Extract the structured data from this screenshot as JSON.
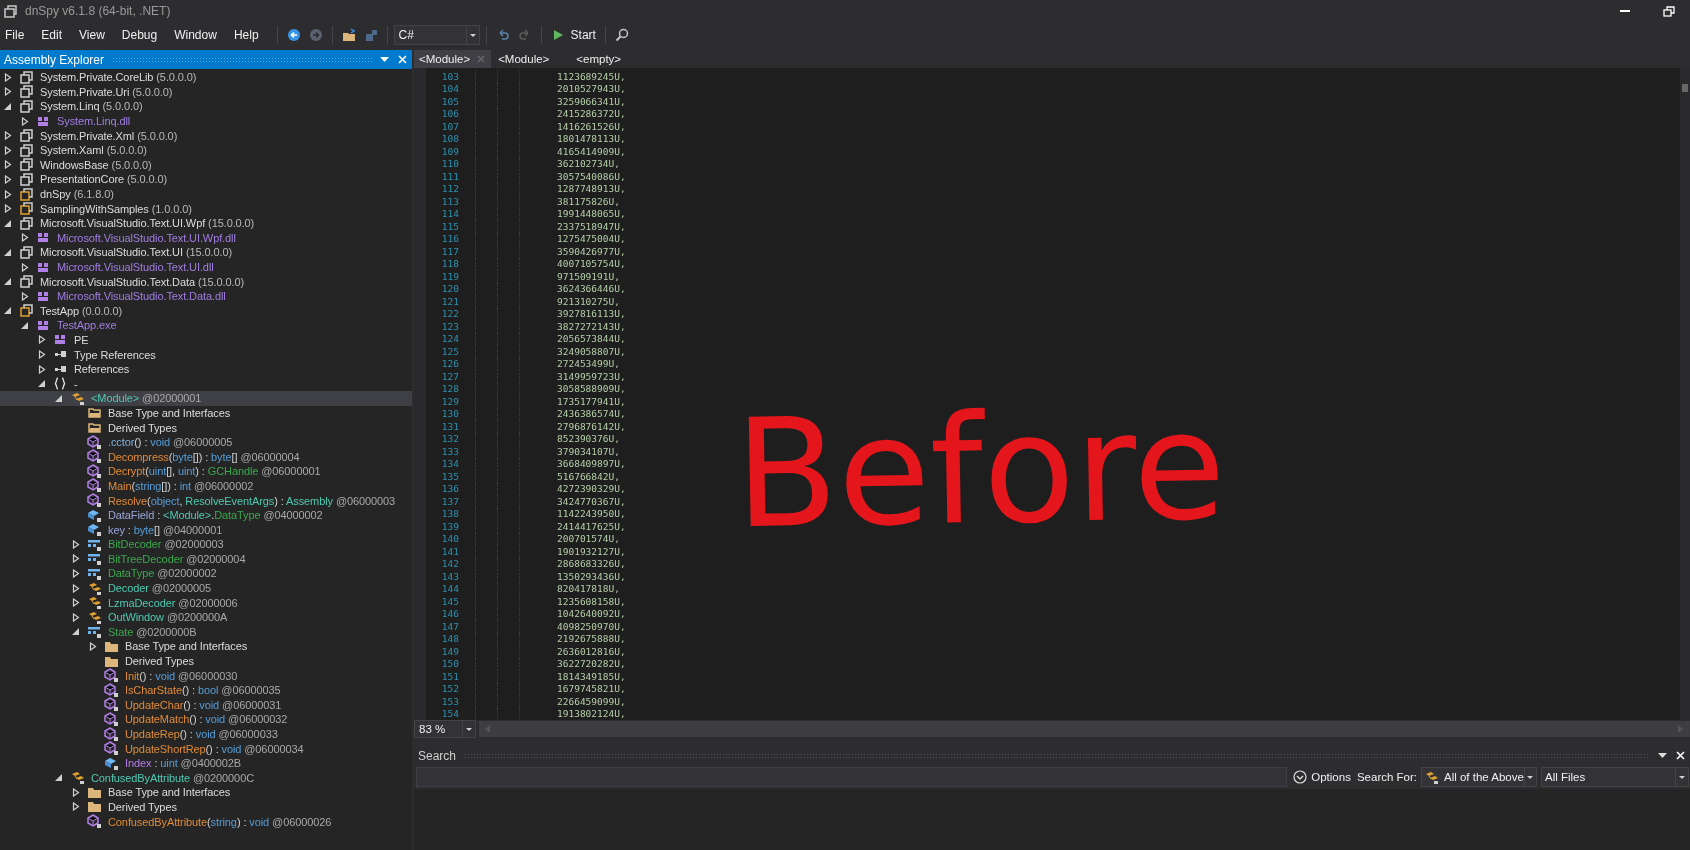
{
  "window": {
    "title": "dnSpy v6.1.8 (64-bit, .NET)"
  },
  "menu": [
    "File",
    "Edit",
    "View",
    "Debug",
    "Window",
    "Help"
  ],
  "toolbar": {
    "language": "C#",
    "start": "Start"
  },
  "explorer": {
    "title": "Assembly Explorer",
    "tree": [
      {
        "kind": "assembly",
        "expanded": false,
        "selected": false,
        "parts": [
          {
            "text": "System.Private.CoreLib",
            "kind": "name"
          },
          {
            "text": " (5.0.0.0)",
            "kind": "ver"
          }
        ]
      },
      {
        "kind": "assembly",
        "expanded": false,
        "selected": false,
        "parts": [
          {
            "text": "System.Private.Uri",
            "kind": "name"
          },
          {
            "text": " (5.0.0.0)",
            "kind": "ver"
          }
        ]
      },
      {
        "kind": "assembly",
        "expanded": true,
        "selected": false,
        "parts": [
          {
            "text": "System.Linq",
            "kind": "name"
          },
          {
            "text": " (5.0.0.0)",
            "kind": "ver"
          }
        ],
        "children": [
          {
            "kind": "module",
            "expanded": false,
            "selected": false,
            "parts": [
              {
                "text": "System.Linq.dll",
                "kind": "dll"
              }
            ]
          }
        ]
      },
      {
        "kind": "assembly",
        "expanded": false,
        "selected": false,
        "parts": [
          {
            "text": "System.Private.Xml",
            "kind": "name"
          },
          {
            "text": " (5.0.0.0)",
            "kind": "ver"
          }
        ]
      },
      {
        "kind": "assembly",
        "expanded": false,
        "selected": false,
        "parts": [
          {
            "text": "System.Xaml",
            "kind": "name"
          },
          {
            "text": " (5.0.0.0)",
            "kind": "ver"
          }
        ]
      },
      {
        "kind": "assembly",
        "expanded": false,
        "selected": false,
        "parts": [
          {
            "text": "WindowsBase",
            "kind": "name"
          },
          {
            "text": " (5.0.0.0)",
            "kind": "ver"
          }
        ]
      },
      {
        "kind": "assembly",
        "expanded": false,
        "selected": false,
        "parts": [
          {
            "text": "PresentationCore",
            "kind": "name"
          },
          {
            "text": " (5.0.0.0)",
            "kind": "ver"
          }
        ]
      },
      {
        "kind": "assembly-exe",
        "expanded": false,
        "selected": false,
        "parts": [
          {
            "text": "dnSpy",
            "kind": "name"
          },
          {
            "text": " (6.1.8.0)",
            "kind": "ver"
          }
        ]
      },
      {
        "kind": "assembly-exe",
        "expanded": false,
        "selected": false,
        "parts": [
          {
            "text": "SamplingWithSamples",
            "kind": "name"
          },
          {
            "text": " (1.0.0.0)",
            "kind": "ver"
          }
        ]
      },
      {
        "kind": "assembly",
        "expanded": true,
        "selected": false,
        "parts": [
          {
            "text": "Microsoft.VisualStudio.Text.UI.Wpf",
            "kind": "name"
          },
          {
            "text": " (15.0.0.0)",
            "kind": "ver"
          }
        ],
        "children": [
          {
            "kind": "module",
            "expanded": false,
            "selected": false,
            "parts": [
              {
                "text": "Microsoft.VisualStudio.Text.UI.Wpf.dll",
                "kind": "dll"
              }
            ]
          }
        ]
      },
      {
        "kind": "assembly",
        "expanded": true,
        "selected": false,
        "parts": [
          {
            "text": "Microsoft.VisualStudio.Text.UI",
            "kind": "name"
          },
          {
            "text": " (15.0.0.0)",
            "kind": "ver"
          }
        ],
        "children": [
          {
            "kind": "module",
            "expanded": false,
            "selected": false,
            "parts": [
              {
                "text": "Microsoft.VisualStudio.Text.UI.dll",
                "kind": "dll"
              }
            ]
          }
        ]
      },
      {
        "kind": "assembly",
        "expanded": true,
        "selected": false,
        "parts": [
          {
            "text": "Microsoft.VisualStudio.Text.Data",
            "kind": "name"
          },
          {
            "text": " (15.0.0.0)",
            "kind": "ver"
          }
        ],
        "children": [
          {
            "kind": "module",
            "expanded": false,
            "selected": false,
            "parts": [
              {
                "text": "Microsoft.VisualStudio.Text.Data.dll",
                "kind": "dll"
              }
            ]
          }
        ]
      },
      {
        "kind": "assembly-exe",
        "expanded": true,
        "selected": false,
        "parts": [
          {
            "text": "TestApp",
            "kind": "name"
          },
          {
            "text": " (0.0.0.0)",
            "kind": "ver"
          }
        ],
        "children": [
          {
            "kind": "module",
            "expanded": true,
            "selected": false,
            "parts": [
              {
                "text": "TestApp.exe",
                "kind": "dll"
              }
            ],
            "children": [
              {
                "kind": "module",
                "expanded": false,
                "selected": false,
                "parts": [
                  {
                    "text": "PE",
                    "kind": "name"
                  }
                ]
              },
              {
                "kind": "refs",
                "expanded": false,
                "selected": false,
                "parts": [
                  {
                    "text": "Type References",
                    "kind": "name"
                  }
                ]
              },
              {
                "kind": "refs",
                "expanded": false,
                "selected": false,
                "parts": [
                  {
                    "text": "References",
                    "kind": "name"
                  }
                ]
              },
              {
                "kind": "namespace",
                "expanded": true,
                "selected": false,
                "parts": [
                  {
                    "text": "-",
                    "kind": "name"
                  }
                ],
                "children": [
                  {
                    "kind": "class",
                    "expanded": true,
                    "selected": true,
                    "parts": [
                      {
                        "text": "<Module>",
                        "kind": "type"
                      },
                      {
                        "text": " @02000001",
                        "kind": "tok"
                      }
                    ],
                    "children": [
                      {
                        "kind": "folder-open",
                        "selected": false,
                        "parts": [
                          {
                            "text": "Base Type and Interfaces",
                            "kind": "name"
                          }
                        ]
                      },
                      {
                        "kind": "folder-open",
                        "selected": false,
                        "parts": [
                          {
                            "text": "Derived Types",
                            "kind": "name"
                          }
                        ]
                      },
                      {
                        "kind": "method",
                        "selected": false,
                        "parts": [
                          {
                            "text": ".cctor",
                            "kind": "ctor"
                          },
                          {
                            "text": "() : ",
                            "kind": "punct"
                          },
                          {
                            "text": "void",
                            "kind": "kw"
                          },
                          {
                            "text": " @06000005",
                            "kind": "tok"
                          }
                        ]
                      },
                      {
                        "kind": "method",
                        "selected": false,
                        "parts": [
                          {
                            "text": "Decompress",
                            "kind": "method"
                          },
                          {
                            "text": "(",
                            "kind": "punct"
                          },
                          {
                            "text": "byte",
                            "kind": "kw"
                          },
                          {
                            "text": "[]) : ",
                            "kind": "punct"
                          },
                          {
                            "text": "byte",
                            "kind": "kw"
                          },
                          {
                            "text": "[]",
                            "kind": "punct"
                          },
                          {
                            "text": " @06000004",
                            "kind": "tok"
                          }
                        ]
                      },
                      {
                        "kind": "method",
                        "selected": false,
                        "parts": [
                          {
                            "text": "Decrypt",
                            "kind": "method"
                          },
                          {
                            "text": "(",
                            "kind": "punct"
                          },
                          {
                            "text": "uint",
                            "kind": "kw"
                          },
                          {
                            "text": "[], ",
                            "kind": "punct"
                          },
                          {
                            "text": "uint",
                            "kind": "kw"
                          },
                          {
                            "text": ") : ",
                            "kind": "punct"
                          },
                          {
                            "text": "GCHandle",
                            "kind": "struct"
                          },
                          {
                            "text": " @06000001",
                            "kind": "tok"
                          }
                        ]
                      },
                      {
                        "kind": "method",
                        "selected": false,
                        "parts": [
                          {
                            "text": "Main",
                            "kind": "method"
                          },
                          {
                            "text": "(",
                            "kind": "punct"
                          },
                          {
                            "text": "string",
                            "kind": "kw"
                          },
                          {
                            "text": "[]) : ",
                            "kind": "punct"
                          },
                          {
                            "text": "int",
                            "kind": "kw"
                          },
                          {
                            "text": " @06000002",
                            "kind": "tok"
                          }
                        ]
                      },
                      {
                        "kind": "method",
                        "selected": false,
                        "parts": [
                          {
                            "text": "Resolve",
                            "kind": "method"
                          },
                          {
                            "text": "(",
                            "kind": "punct"
                          },
                          {
                            "text": "object",
                            "kind": "kw"
                          },
                          {
                            "text": ", ",
                            "kind": "punct"
                          },
                          {
                            "text": "ResolveEventArgs",
                            "kind": "type"
                          },
                          {
                            "text": ") : ",
                            "kind": "punct"
                          },
                          {
                            "text": "Assembly",
                            "kind": "type"
                          },
                          {
                            "text": " @06000003",
                            "kind": "tok"
                          }
                        ]
                      },
                      {
                        "kind": "field",
                        "selected": false,
                        "parts": [
                          {
                            "text": "DataField",
                            "kind": "field"
                          },
                          {
                            "text": " : ",
                            "kind": "punct"
                          },
                          {
                            "text": "<Module>",
                            "kind": "type"
                          },
                          {
                            "text": ".",
                            "kind": "punct"
                          },
                          {
                            "text": "DataType",
                            "kind": "struct"
                          },
                          {
                            "text": " @04000002",
                            "kind": "tok"
                          }
                        ]
                      },
                      {
                        "kind": "field",
                        "selected": false,
                        "parts": [
                          {
                            "text": "key",
                            "kind": "field"
                          },
                          {
                            "text": " : ",
                            "kind": "punct"
                          },
                          {
                            "text": "byte",
                            "kind": "kw"
                          },
                          {
                            "text": "[]",
                            "kind": "punct"
                          },
                          {
                            "text": " @04000001",
                            "kind": "tok"
                          }
                        ]
                      },
                      {
                        "kind": "struct",
                        "expanded": false,
                        "selected": false,
                        "parts": [
                          {
                            "text": "BitDecoder",
                            "kind": "struct"
                          },
                          {
                            "text": " @02000003",
                            "kind": "tok"
                          }
                        ]
                      },
                      {
                        "kind": "struct",
                        "expanded": false,
                        "selected": false,
                        "parts": [
                          {
                            "text": "BitTreeDecoder",
                            "kind": "struct"
                          },
                          {
                            "text": " @02000004",
                            "kind": "tok"
                          }
                        ]
                      },
                      {
                        "kind": "struct",
                        "expanded": false,
                        "selected": false,
                        "parts": [
                          {
                            "text": "DataType",
                            "kind": "struct"
                          },
                          {
                            "text": " @02000002",
                            "kind": "tok"
                          }
                        ]
                      },
                      {
                        "kind": "class",
                        "expanded": false,
                        "selected": false,
                        "parts": [
                          {
                            "text": "Decoder",
                            "kind": "type"
                          },
                          {
                            "text": " @02000005",
                            "kind": "tok"
                          }
                        ]
                      },
                      {
                        "kind": "class",
                        "expanded": false,
                        "selected": false,
                        "parts": [
                          {
                            "text": "LzmaDecoder",
                            "kind": "type"
                          },
                          {
                            "text": " @02000006",
                            "kind": "tok"
                          }
                        ]
                      },
                      {
                        "kind": "class",
                        "expanded": false,
                        "selected": false,
                        "parts": [
                          {
                            "text": "OutWindow",
                            "kind": "type"
                          },
                          {
                            "text": " @0200000A",
                            "kind": "tok"
                          }
                        ]
                      },
                      {
                        "kind": "struct",
                        "expanded": true,
                        "selected": false,
                        "parts": [
                          {
                            "text": "State",
                            "kind": "struct"
                          },
                          {
                            "text": " @0200000B",
                            "kind": "tok"
                          }
                        ],
                        "children": [
                          {
                            "kind": "folder",
                            "expanded": false,
                            "selected": false,
                            "parts": [
                              {
                                "text": "Base Type and Interfaces",
                                "kind": "name"
                              }
                            ]
                          },
                          {
                            "kind": "folder",
                            "selected": false,
                            "parts": [
                              {
                                "text": "Derived Types",
                                "kind": "name"
                              }
                            ]
                          },
                          {
                            "kind": "method",
                            "selected": false,
                            "parts": [
                              {
                                "text": "Init",
                                "kind": "method"
                              },
                              {
                                "text": "() : ",
                                "kind": "punct"
                              },
                              {
                                "text": "void",
                                "kind": "kw"
                              },
                              {
                                "text": " @06000030",
                                "kind": "tok"
                              }
                            ]
                          },
                          {
                            "kind": "method",
                            "selected": false,
                            "parts": [
                              {
                                "text": "IsCharState",
                                "kind": "method"
                              },
                              {
                                "text": "() : ",
                                "kind": "punct"
                              },
                              {
                                "text": "bool",
                                "kind": "kw"
                              },
                              {
                                "text": " @06000035",
                                "kind": "tok"
                              }
                            ]
                          },
                          {
                            "kind": "method",
                            "selected": false,
                            "parts": [
                              {
                                "text": "UpdateChar",
                                "kind": "method"
                              },
                              {
                                "text": "() : ",
                                "kind": "punct"
                              },
                              {
                                "text": "void",
                                "kind": "kw"
                              },
                              {
                                "text": " @06000031",
                                "kind": "tok"
                              }
                            ]
                          },
                          {
                            "kind": "method",
                            "selected": false,
                            "parts": [
                              {
                                "text": "UpdateMatch",
                                "kind": "method"
                              },
                              {
                                "text": "() : ",
                                "kind": "punct"
                              },
                              {
                                "text": "void",
                                "kind": "kw"
                              },
                              {
                                "text": " @06000032",
                                "kind": "tok"
                              }
                            ]
                          },
                          {
                            "kind": "method",
                            "selected": false,
                            "parts": [
                              {
                                "text": "UpdateRep",
                                "kind": "method"
                              },
                              {
                                "text": "() : ",
                                "kind": "punct"
                              },
                              {
                                "text": "void",
                                "kind": "kw"
                              },
                              {
                                "text": " @06000033",
                                "kind": "tok"
                              }
                            ]
                          },
                          {
                            "kind": "method",
                            "selected": false,
                            "parts": [
                              {
                                "text": "UpdateShortRep",
                                "kind": "method"
                              },
                              {
                                "text": "() : ",
                                "kind": "punct"
                              },
                              {
                                "text": "void",
                                "kind": "kw"
                              },
                              {
                                "text": " @06000034",
                                "kind": "tok"
                              }
                            ]
                          },
                          {
                            "kind": "field",
                            "selected": false,
                            "parts": [
                              {
                                "text": "Index",
                                "kind": "prop"
                              },
                              {
                                "text": " : ",
                                "kind": "punct"
                              },
                              {
                                "text": "uint",
                                "kind": "kw"
                              },
                              {
                                "text": " @0400002B",
                                "kind": "tok"
                              }
                            ]
                          }
                        ]
                      }
                    ]
                  },
                  {
                    "kind": "class",
                    "expanded": true,
                    "selected": false,
                    "parts": [
                      {
                        "text": "ConfusedByAttribute",
                        "kind": "type"
                      },
                      {
                        "text": " @0200000C",
                        "kind": "tok"
                      }
                    ],
                    "children": [
                      {
                        "kind": "folder",
                        "expanded": false,
                        "selected": false,
                        "parts": [
                          {
                            "text": "Base Type and Interfaces",
                            "kind": "name"
                          }
                        ]
                      },
                      {
                        "kind": "folder",
                        "expanded": false,
                        "selected": false,
                        "parts": [
                          {
                            "text": "Derived Types",
                            "kind": "name"
                          }
                        ]
                      },
                      {
                        "kind": "method",
                        "selected": false,
                        "parts": [
                          {
                            "text": "ConfusedByAttribute",
                            "kind": "method"
                          },
                          {
                            "text": "(",
                            "kind": "punct"
                          },
                          {
                            "text": "string",
                            "kind": "kw"
                          },
                          {
                            "text": ") : ",
                            "kind": "punct"
                          },
                          {
                            "text": "void",
                            "kind": "kw"
                          },
                          {
                            "text": " @06000026",
                            "kind": "tok"
                          }
                        ]
                      }
                    ]
                  }
                ]
              }
            ]
          }
        ]
      }
    ]
  },
  "tabs": [
    {
      "label": "<Module>",
      "selected": true
    },
    {
      "label": "<Module>",
      "selected": false
    },
    {
      "label": "<empty>",
      "selected": false
    }
  ],
  "editor": {
    "zoom": "83 %",
    "lines": [
      [
        "103",
        "1123689245U,"
      ],
      [
        "104",
        "2010527943U,"
      ],
      [
        "105",
        "3259066341U,"
      ],
      [
        "106",
        "2415286372U,"
      ],
      [
        "107",
        "1416261526U,"
      ],
      [
        "108",
        "1801478113U,"
      ],
      [
        "109",
        "4165414909U,"
      ],
      [
        "110",
        "362102734U,"
      ],
      [
        "111",
        "3057540086U,"
      ],
      [
        "112",
        "1287748913U,"
      ],
      [
        "113",
        "381175826U,"
      ],
      [
        "114",
        "1991448065U,"
      ],
      [
        "115",
        "2337518947U,"
      ],
      [
        "116",
        "1275475004U,"
      ],
      [
        "117",
        "3590426977U,"
      ],
      [
        "118",
        "4007105754U,"
      ],
      [
        "119",
        "971509191U,"
      ],
      [
        "120",
        "3624366446U,"
      ],
      [
        "121",
        "921310275U,"
      ],
      [
        "122",
        "3927816113U,"
      ],
      [
        "123",
        "3827272143U,"
      ],
      [
        "124",
        "2056573844U,"
      ],
      [
        "125",
        "3249058807U,"
      ],
      [
        "126",
        "272453499U,"
      ],
      [
        "127",
        "3149959723U,"
      ],
      [
        "128",
        "3058588909U,"
      ],
      [
        "129",
        "1735177941U,"
      ],
      [
        "130",
        "2436386574U,"
      ],
      [
        "131",
        "2796876142U,"
      ],
      [
        "132",
        "852390376U,"
      ],
      [
        "133",
        "379034107U,"
      ],
      [
        "134",
        "3668409897U,"
      ],
      [
        "135",
        "516766842U,"
      ],
      [
        "136",
        "4272390329U,"
      ],
      [
        "137",
        "3424770367U,"
      ],
      [
        "138",
        "1142243950U,"
      ],
      [
        "139",
        "2414417625U,"
      ],
      [
        "140",
        "200701574U,"
      ],
      [
        "141",
        "1901932127U,"
      ],
      [
        "142",
        "2868683326U,"
      ],
      [
        "143",
        "1350293436U,"
      ],
      [
        "144",
        "820417818U,"
      ],
      [
        "145",
        "1235608158U,"
      ],
      [
        "146",
        "1042640092U,"
      ],
      [
        "147",
        "4098250970U,"
      ],
      [
        "148",
        "2192675888U,"
      ],
      [
        "149",
        "2636012816U,"
      ],
      [
        "150",
        "3622720282U,"
      ],
      [
        "151",
        "1814349185U,"
      ],
      [
        "152",
        "1679745821U,"
      ],
      [
        "153",
        "2266459099U,"
      ],
      [
        "154",
        "1913802124U,"
      ]
    ]
  },
  "search": {
    "title": "Search",
    "options": "Options",
    "search_for_label": "Search For:",
    "search_for": "All of the Above",
    "scope": "All Files"
  },
  "annotation": {
    "text": "Before"
  }
}
